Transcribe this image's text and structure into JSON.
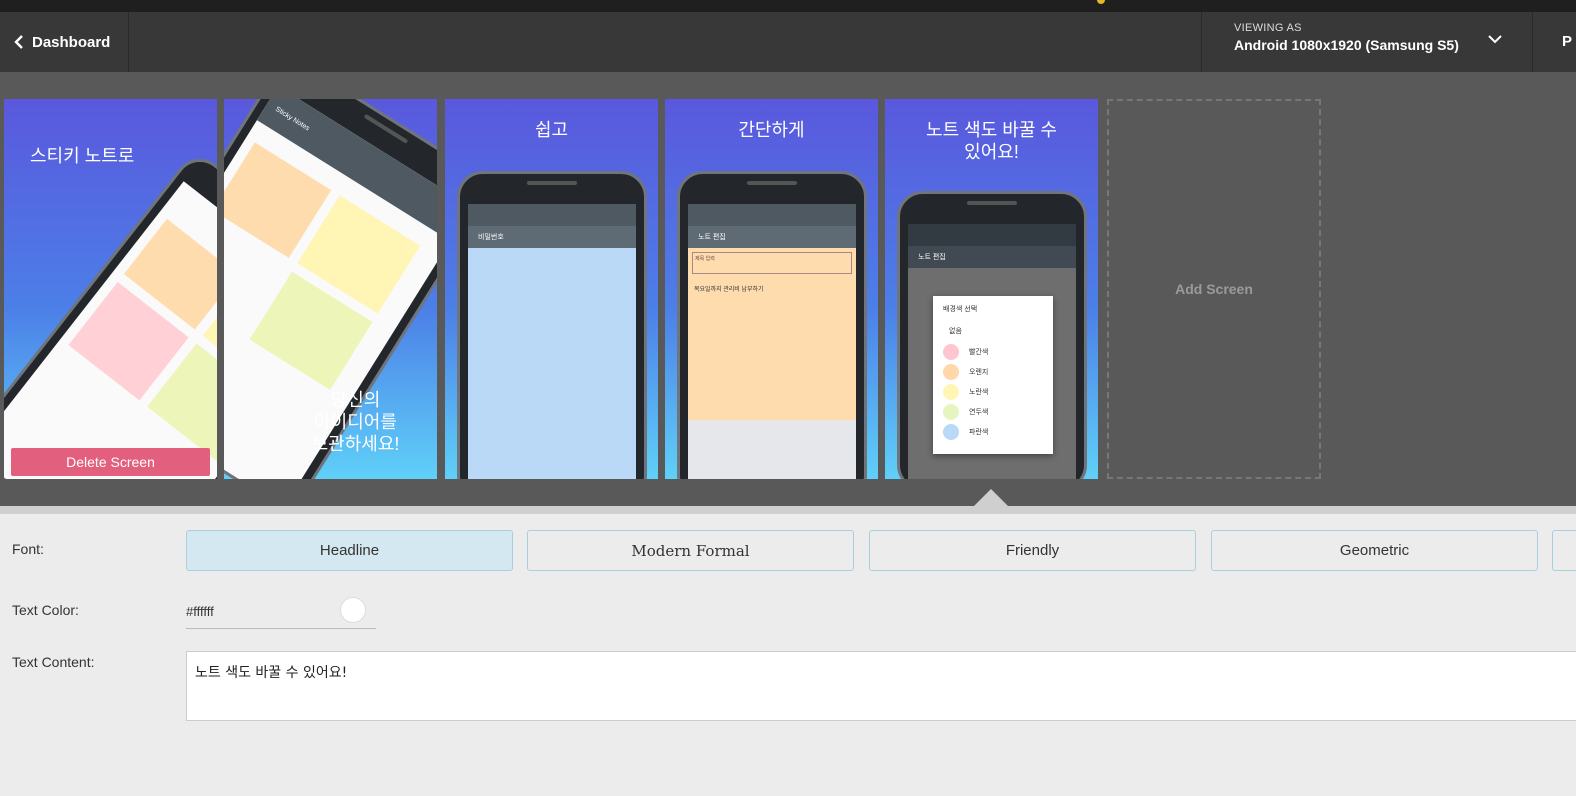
{
  "header": {
    "back_label": "Dashboard",
    "viewing_label": "VIEWING AS",
    "viewing_value": "Android 1080x1920 (Samsung S5)",
    "cut_label": "P"
  },
  "screens": [
    {
      "caption_top": "스티키 노트로",
      "delete_label": "Delete Screen"
    },
    {
      "caption_bottom": "당신의\n아이디어를\n보관하세요!",
      "app_title": "Sticky Notes"
    },
    {
      "caption_top": "쉽고",
      "app_title": "비밀번호"
    },
    {
      "caption_top": "간단하게",
      "app_title": "노트 편집",
      "field_label": "제목 입력",
      "body_text": "목요일까지 관리비 납부하기"
    },
    {
      "caption_top": "노트 색도 바꿀 수\n있어요!",
      "app_title": "노트 편집",
      "dialog_title": "배경색 선택",
      "dialog_options": [
        "없음",
        "빨간색",
        "오렌지",
        "노란색",
        "연두색",
        "파란색"
      ]
    }
  ],
  "add_screen_label": "Add Screen",
  "panel": {
    "font_label": "Font:",
    "font_options": [
      "Headline",
      "Modern Formal",
      "Friendly",
      "Geometric"
    ],
    "text_color_label": "Text Color:",
    "text_color_value": "#ffffff",
    "text_content_label": "Text Content:",
    "text_content_value": "노트 색도 바꿀 수 있어요!"
  },
  "colors": {
    "header_bg": "#383838",
    "stage_bg": "#595959",
    "active_font_bg": "#d4e8f1",
    "delete_bg": "#e2607d"
  }
}
